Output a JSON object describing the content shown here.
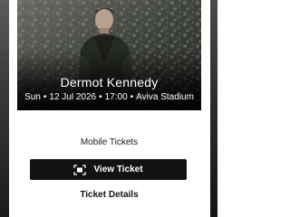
{
  "event": {
    "artist": "Dermot Kennedy",
    "day": "Sun",
    "date": "12 Jul 2026",
    "time": "17:00",
    "venue": "Aviva Stadium",
    "separator": "•"
  },
  "ticket": {
    "type_label": "Mobile Tickets",
    "view_button_label": "View Ticket",
    "view_button_icon": "ticket-scan-icon",
    "details_label": "Ticket Details"
  },
  "colors": {
    "button_bg": "#121212",
    "button_text": "#ffffff",
    "hero_text": "#ffffff",
    "body_bg": "#ffffff"
  }
}
